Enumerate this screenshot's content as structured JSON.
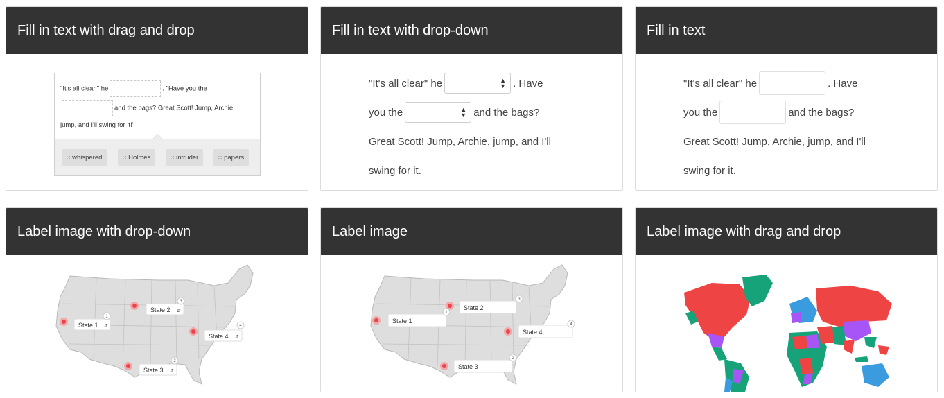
{
  "cards": [
    {
      "title": "Fill in text with drag and drop"
    },
    {
      "title": "Fill in text with drop-down"
    },
    {
      "title": "Fill in text"
    },
    {
      "title": "Label image with drop-down"
    },
    {
      "title": "Label image"
    },
    {
      "title": "Label image with drag and drop"
    }
  ],
  "dnd": {
    "t1": "\"It's all clear,\" he",
    "t2": ". \"Have you the",
    "t3": "and the bags? Great Scott! Jump, Archie,",
    "t4": "jump, and I'll swing for it!\"",
    "choices": [
      "whispered",
      "Holmes",
      "intruder",
      "papers"
    ]
  },
  "dropdown_text": {
    "t1": "\"It's all clear\" he",
    "t2": ". Have",
    "t3": "you the",
    "t4": "and the bags?",
    "t5": "Great Scott! Jump, Archie, jump, and I'll",
    "t6": "swing for it."
  },
  "fill_text": {
    "t1": "\"It's all clear\" he",
    "t2": ". Have",
    "t3": "you the",
    "t4": "and the bags?",
    "t5": "Great Scott! Jump, Archie, jump, and I'll",
    "t6": "swing for it."
  },
  "map_labels": {
    "s1": "State 1",
    "s2": "State 2",
    "s3": "State 3",
    "s4": "State 4",
    "n1": "1",
    "n2": "2",
    "n3": "3",
    "n4": "4"
  },
  "colors": {
    "header": "#333333",
    "pin": "#e8434a",
    "map_fill": "#dedede",
    "world_red": "#ef4444",
    "world_green": "#16a37a",
    "world_purple": "#a855f7",
    "world_blue": "#3b9bdf"
  }
}
